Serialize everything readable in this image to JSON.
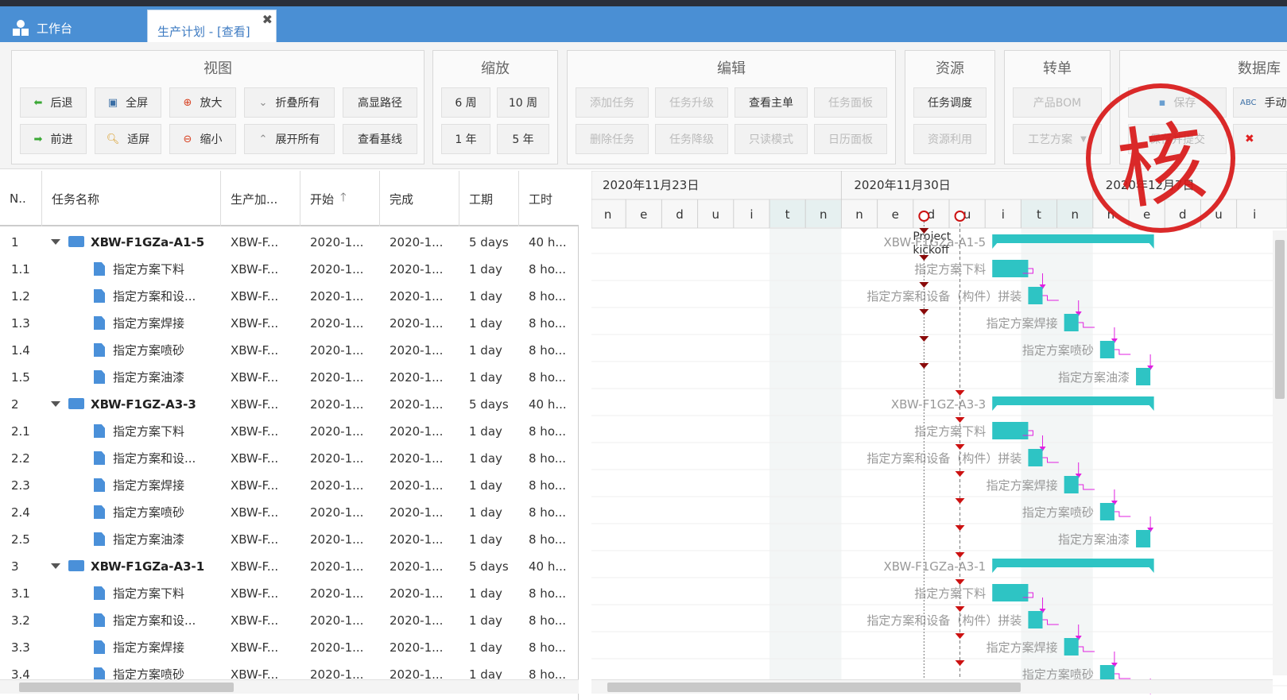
{
  "tabs": {
    "home_label": "工作台",
    "active_label": "生产计划 - [查看]"
  },
  "ribbon": {
    "view": {
      "title": "视图",
      "back": "后退",
      "forward": "前进",
      "fullscreen": "全屏",
      "fit": "适屏",
      "zoom_in": "放大",
      "zoom_out": "缩小",
      "collapse_all": "折叠所有",
      "expand_all": "展开所有",
      "highlight_path": "高显路径",
      "view_baseline": "查看基线"
    },
    "zoom": {
      "title": "缩放",
      "w6": "6 周",
      "w10": "10 周",
      "y1": "1 年",
      "y5": "5 年"
    },
    "edit": {
      "title": "编辑",
      "add_task": "添加任务",
      "upgrade": "任务升级",
      "view_main": "查看主单",
      "panel": "任务面板",
      "delete_task": "删除任务",
      "downgrade": "任务降级",
      "readonly": "只读模式",
      "calendar": "日历面板"
    },
    "resource": {
      "title": "资源",
      "dispatch": "任务调度",
      "utilization": "资源利用"
    },
    "convert": {
      "title": "转单",
      "bom": "产品BOM",
      "process": "工艺方案"
    },
    "db": {
      "title": "数据库",
      "save": "保存",
      "submit": "保存并提交",
      "manual": "手动"
    }
  },
  "stamp": "核",
  "grid": {
    "headers": [
      "N..",
      "任务名称",
      "生产加...",
      "开始",
      "完成",
      "工期",
      "工时"
    ],
    "rows": [
      {
        "n": "1",
        "name": "XBW-F1GZa-A1-5",
        "prod": "XBW-F...",
        "start": "2020-1...",
        "end": "2020-1...",
        "dur": "5 days",
        "work": "40 h...",
        "parent": true
      },
      {
        "n": "1.1",
        "name": "指定方案下料",
        "prod": "XBW-F...",
        "start": "2020-1...",
        "end": "2020-1...",
        "dur": "1 day",
        "work": "8 ho...",
        "parent": false
      },
      {
        "n": "1.2",
        "name": "指定方案和设...",
        "prod": "XBW-F...",
        "start": "2020-1...",
        "end": "2020-1...",
        "dur": "1 day",
        "work": "8 ho...",
        "parent": false
      },
      {
        "n": "1.3",
        "name": "指定方案焊接",
        "prod": "XBW-F...",
        "start": "2020-1...",
        "end": "2020-1...",
        "dur": "1 day",
        "work": "8 ho...",
        "parent": false
      },
      {
        "n": "1.4",
        "name": "指定方案喷砂",
        "prod": "XBW-F...",
        "start": "2020-1...",
        "end": "2020-1...",
        "dur": "1 day",
        "work": "8 ho...",
        "parent": false
      },
      {
        "n": "1.5",
        "name": "指定方案油漆",
        "prod": "XBW-F...",
        "start": "2020-1...",
        "end": "2020-1...",
        "dur": "1 day",
        "work": "8 ho...",
        "parent": false
      },
      {
        "n": "2",
        "name": "XBW-F1GZ-A3-3",
        "prod": "XBW-F...",
        "start": "2020-1...",
        "end": "2020-1...",
        "dur": "5 days",
        "work": "40 h...",
        "parent": true
      },
      {
        "n": "2.1",
        "name": "指定方案下料",
        "prod": "XBW-F...",
        "start": "2020-1...",
        "end": "2020-1...",
        "dur": "1 day",
        "work": "8 ho...",
        "parent": false
      },
      {
        "n": "2.2",
        "name": "指定方案和设...",
        "prod": "XBW-F...",
        "start": "2020-1...",
        "end": "2020-1...",
        "dur": "1 day",
        "work": "8 ho...",
        "parent": false
      },
      {
        "n": "2.3",
        "name": "指定方案焊接",
        "prod": "XBW-F...",
        "start": "2020-1...",
        "end": "2020-1...",
        "dur": "1 day",
        "work": "8 ho...",
        "parent": false
      },
      {
        "n": "2.4",
        "name": "指定方案喷砂",
        "prod": "XBW-F...",
        "start": "2020-1...",
        "end": "2020-1...",
        "dur": "1 day",
        "work": "8 ho...",
        "parent": false
      },
      {
        "n": "2.5",
        "name": "指定方案油漆",
        "prod": "XBW-F...",
        "start": "2020-1...",
        "end": "2020-1...",
        "dur": "1 day",
        "work": "8 ho...",
        "parent": false
      },
      {
        "n": "3",
        "name": "XBW-F1GZa-A3-1",
        "prod": "XBW-F...",
        "start": "2020-1...",
        "end": "2020-1...",
        "dur": "5 days",
        "work": "40 h...",
        "parent": true
      },
      {
        "n": "3.1",
        "name": "指定方案下料",
        "prod": "XBW-F...",
        "start": "2020-1...",
        "end": "2020-1...",
        "dur": "1 day",
        "work": "8 ho...",
        "parent": false
      },
      {
        "n": "3.2",
        "name": "指定方案和设...",
        "prod": "XBW-F...",
        "start": "2020-1...",
        "end": "2020-1...",
        "dur": "1 day",
        "work": "8 ho...",
        "parent": false
      },
      {
        "n": "3.3",
        "name": "指定方案焊接",
        "prod": "XBW-F...",
        "start": "2020-1...",
        "end": "2020-1...",
        "dur": "1 day",
        "work": "8 ho...",
        "parent": false
      },
      {
        "n": "3.4",
        "name": "指定方案喷砂",
        "prod": "XBW-F...",
        "start": "2020-1...",
        "end": "2020-1...",
        "dur": "1 day",
        "work": "8 ho...",
        "parent": false
      }
    ]
  },
  "gantt": {
    "weeks": [
      "2020年11月23日",
      "2020年11月30日",
      "2020年12月7日"
    ],
    "days": [
      "n",
      "e",
      "d",
      "u",
      "i",
      "t",
      "n",
      "n",
      "e",
      "d",
      "u",
      "i",
      "t",
      "n",
      "n",
      "e",
      "d",
      "u",
      "i"
    ],
    "milestone": "Project kickoff",
    "labels": [
      "XBW-F1GZa-A1-5",
      "指定方案下料",
      "指定方案和设备（构件）拼装",
      "指定方案焊接",
      "指定方案喷砂",
      "指定方案油漆",
      "XBW-F1GZ-A3-3",
      "指定方案下料",
      "指定方案和设备（构件）拼装",
      "指定方案焊接",
      "指定方案喷砂",
      "指定方案油漆",
      "XBW-F1GZa-A3-1",
      "指定方案下料",
      "指定方案和设备（构件）拼装",
      "指定方案焊接",
      "指定方案喷砂"
    ],
    "bar_color": "#2ec4c4",
    "link_color": "#e020e0",
    "marker_color": "#cc1111"
  }
}
